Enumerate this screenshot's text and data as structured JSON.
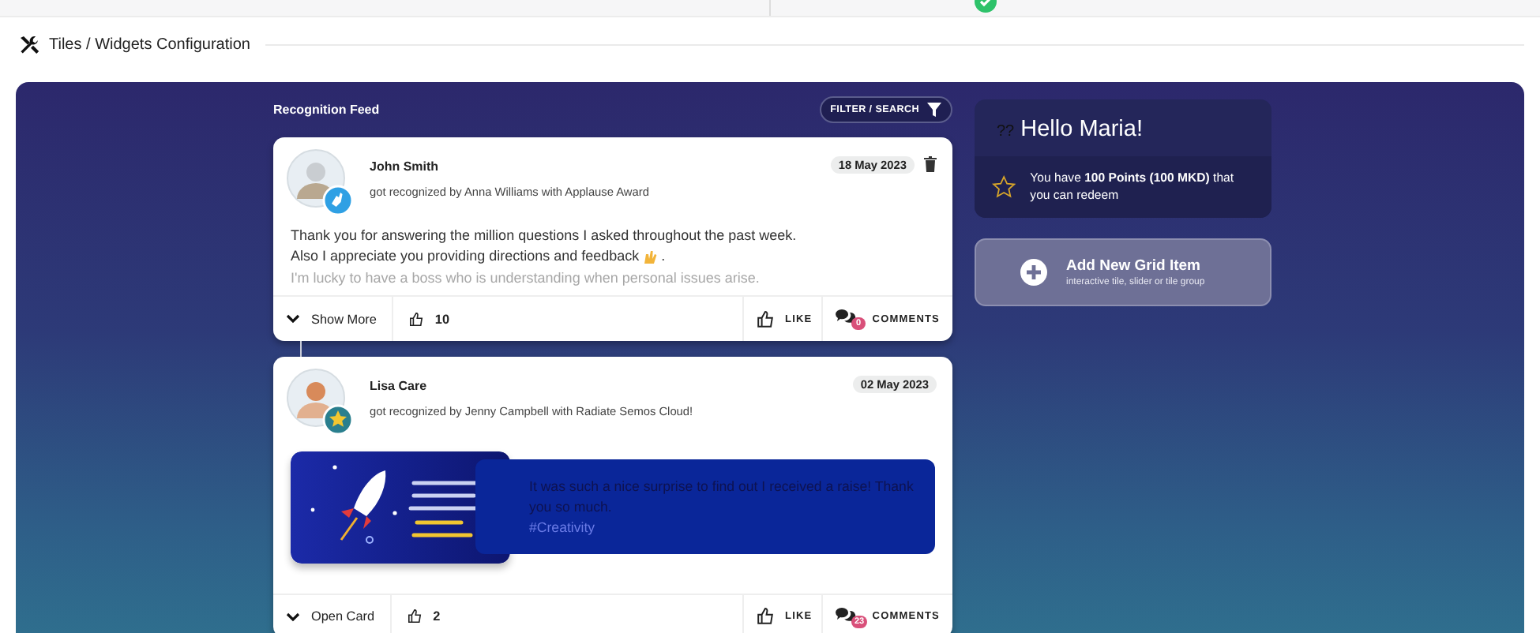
{
  "section_title": "Tiles / Widgets Configuration",
  "feed": {
    "title": "Recognition Feed",
    "filter_button": "FILTER / SEARCH",
    "posts": [
      {
        "kind": "text",
        "badge": {
          "kind": "applause",
          "color": "#2fa0e4"
        },
        "name": "John Smith",
        "subtitle": "got recognized by Anna Williams with Applause Award",
        "date": "18 May 2023",
        "deletable": true,
        "message": [
          {
            "parts": [
              {
                "kind": "text",
                "text": "Thank you for answering the million questions I asked throughout the past week."
              }
            ]
          },
          {
            "parts": [
              {
                "kind": "text",
                "text": "Also I appreciate you providing directions and feedback"
              },
              {
                "kind": "emoji"
              },
              {
                "kind": "text",
                "text": "."
              }
            ]
          },
          {
            "parts": [
              {
                "kind": "text",
                "text": "I'm lucky to have a boss who is understanding when personal issues arise."
              }
            ]
          }
        ],
        "expand_label": "Show More",
        "likes": "10",
        "like_label": "LIKE",
        "comment_count": "0",
        "comments_label": "COMMENTS"
      },
      {
        "badge": {
          "kind": "star",
          "color": "#2a7f8e"
        },
        "name": "Lisa Care",
        "subtitle": "got recognized by Jenny Campbell with Radiate Semos Cloud!",
        "date": "02 May 2023",
        "deletable": false,
        "message": [
          {
            "text": "It was such a nice surprise to find out I received a raise! Thank you so much."
          }
        ],
        "tag": "#Creativity",
        "expand_label": "Open Card",
        "likes": "2",
        "like_label": "LIKE",
        "comment_count": "23",
        "comments_label": "COMMENTS"
      }
    ]
  },
  "hello": {
    "prefix": "??",
    "greeting": "Hello Maria!",
    "points_text": "You have **100 Points (100 MKD)** that you can redeem"
  },
  "add_tile": {
    "title": "Add New Grid Item",
    "subtitle": "interactive tile, slider or tile group"
  }
}
